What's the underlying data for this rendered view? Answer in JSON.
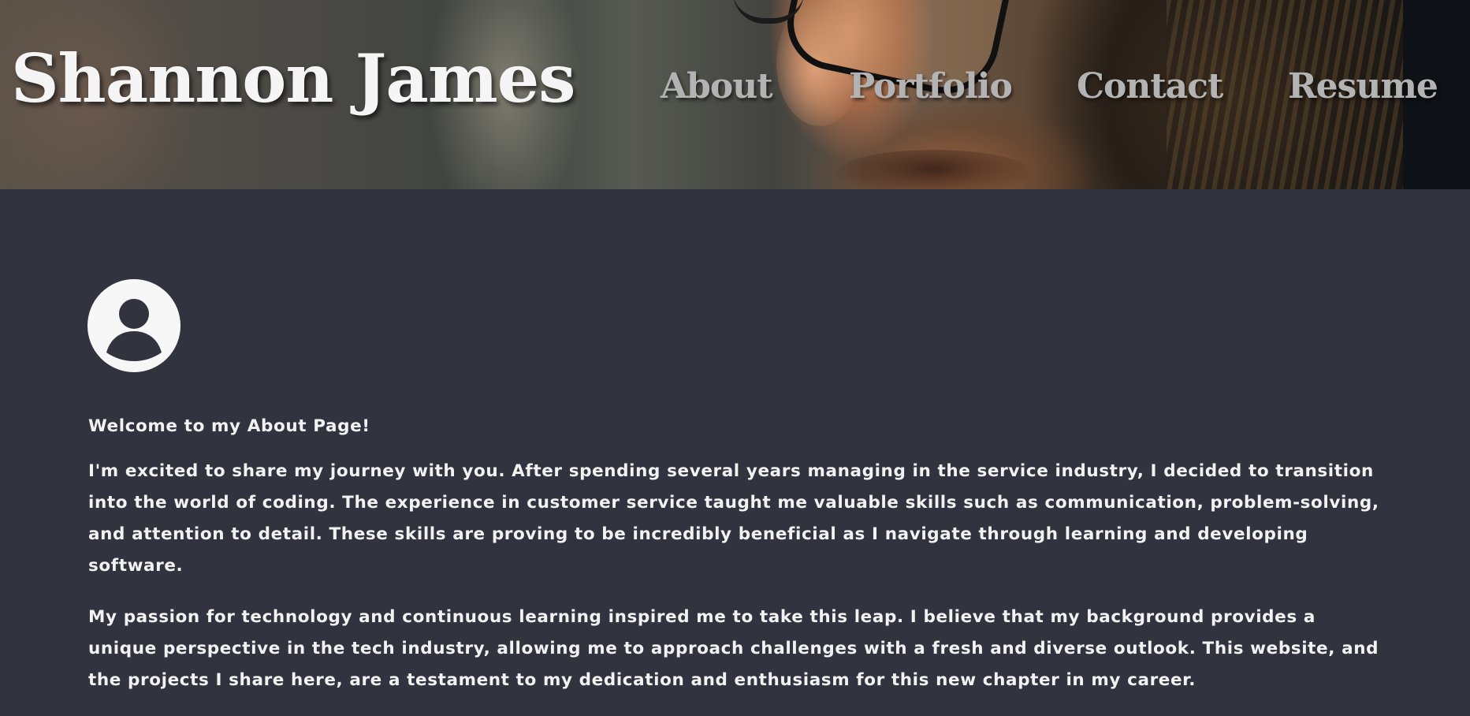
{
  "header": {
    "site_title": "Shannon James",
    "nav": {
      "about": "About",
      "portfolio": "Portfolio",
      "contact": "Contact",
      "resume": "Resume"
    }
  },
  "main": {
    "avatar_icon": "user-circle-icon",
    "welcome": "Welcome to my About Page!",
    "paragraphs": [
      "I'm excited to share my journey with you. After spending several years managing in the service industry, I decided to transition into the world of coding. The experience in customer service taught me valuable skills such as communication, problem-solving, and attention to detail. These skills are proving to be incredibly beneficial as I navigate through learning and developing software.",
      "My passion for technology and continuous learning inspired me to take this leap. I believe that my background provides a unique perspective in the tech industry, allowing me to approach challenges with a fresh and diverse outlook. This website, and the projects I share here, are a testament to my dedication and enthusiasm for this new chapter in my career."
    ]
  },
  "colors": {
    "background": "#31343f",
    "text": "#f2f2f2",
    "nav_text": "#b3b3b3"
  }
}
